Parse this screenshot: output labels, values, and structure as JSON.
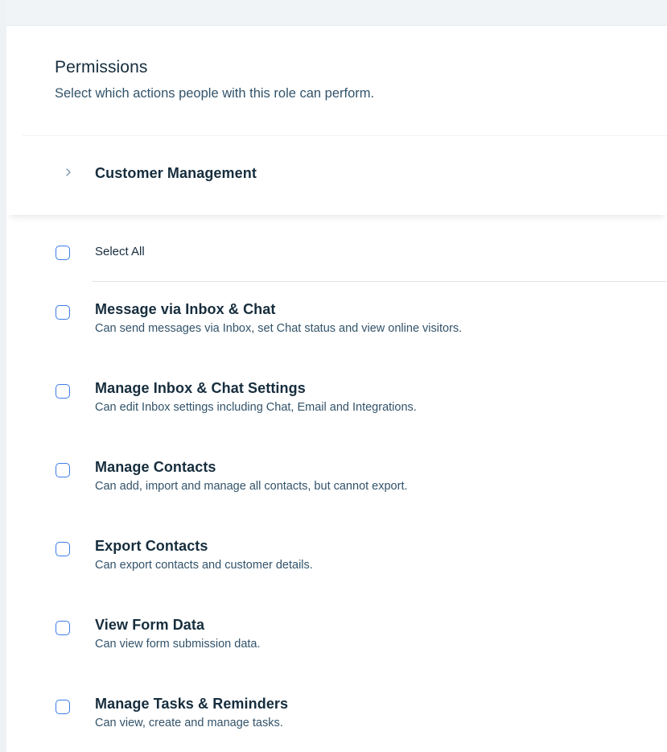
{
  "header": {
    "title": "Permissions",
    "subtitle": "Select which actions people with this role can perform."
  },
  "section": {
    "title": "Customer Management",
    "icon": "chevron-right-icon"
  },
  "select_all": {
    "label": "Select All",
    "checked": false
  },
  "permissions": [
    {
      "title": "Message via Inbox & Chat",
      "description": "Can send messages via Inbox, set Chat status and view online visitors.",
      "checked": false
    },
    {
      "title": "Manage Inbox & Chat Settings",
      "description": "Can edit Inbox settings including Chat, Email and Integrations.",
      "checked": false
    },
    {
      "title": "Manage Contacts",
      "description": "Can add, import and manage all contacts, but cannot export.",
      "checked": false
    },
    {
      "title": "Export Contacts",
      "description": "Can export contacts and customer details.",
      "checked": false
    },
    {
      "title": "View Form Data",
      "description": "Can view form submission data.",
      "checked": false
    },
    {
      "title": "Manage Tasks & Reminders",
      "description": "Can view, create and manage tasks.",
      "checked": false
    }
  ],
  "colors": {
    "checkbox_border": "#3b7ce8",
    "title_text": "#162d3d",
    "secondary_text": "#32536a",
    "page_background": "#f0f4f7"
  }
}
